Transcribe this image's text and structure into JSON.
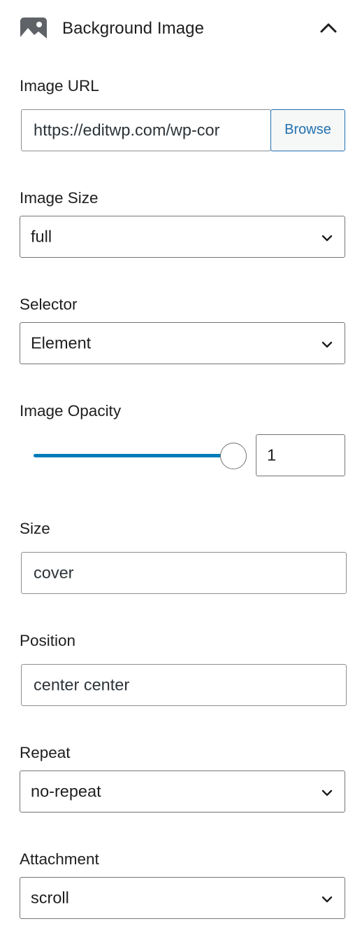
{
  "panel": {
    "title": "Background Image",
    "header_icon": "image-icon",
    "toggle_icon": "chevron-up-icon"
  },
  "image_url": {
    "label": "Image URL",
    "value": "https://editwp.com/wp-cor",
    "browse_label": "Browse"
  },
  "image_size": {
    "label": "Image Size",
    "value": "full"
  },
  "selector": {
    "label": "Selector",
    "value": "Element"
  },
  "image_opacity": {
    "label": "Image Opacity",
    "value": "1",
    "slider_fraction": 1.0
  },
  "size": {
    "label": "Size",
    "value": "cover"
  },
  "position": {
    "label": "Position",
    "value": "center center"
  },
  "repeat": {
    "label": "Repeat",
    "value": "no-repeat"
  },
  "attachment": {
    "label": "Attachment",
    "value": "scroll"
  },
  "colors": {
    "accent": "#007cba",
    "link": "#2271b1",
    "border": "#8c8f94",
    "text": "#1e1e1e"
  }
}
